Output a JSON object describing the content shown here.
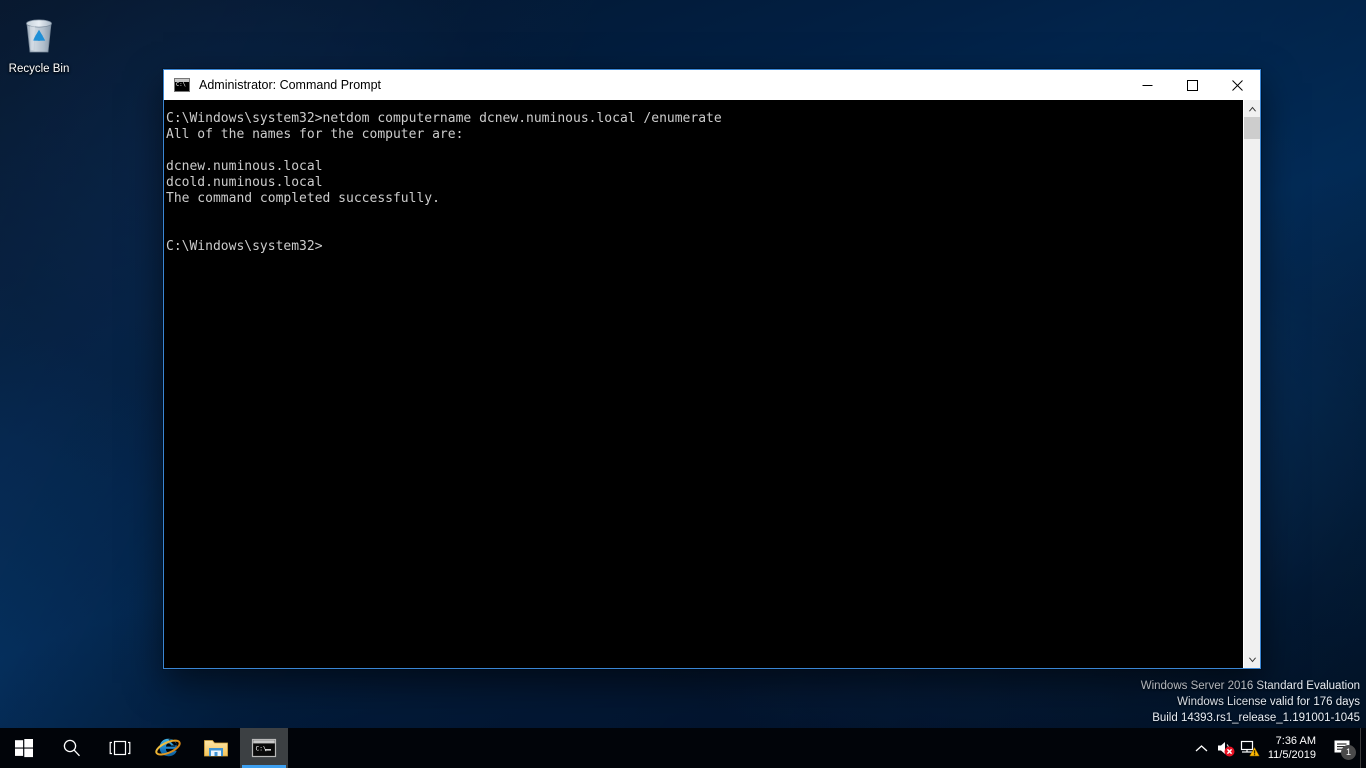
{
  "desktop": {
    "icons": [
      {
        "name": "recycle-bin",
        "label": "Recycle Bin"
      }
    ],
    "wallpaper_color": "#023061"
  },
  "window": {
    "title": "Administrator: Command Prompt",
    "icon": "command-prompt-icon",
    "accent_color": "#3a86d4",
    "controls": {
      "minimize": "—",
      "maximize": "☐",
      "close": "✕"
    },
    "console": {
      "background": "#000000",
      "foreground": "#cccccc",
      "lines": [
        "C:\\Windows\\system32>netdom computername dcnew.numinous.local /enumerate",
        "All of the names for the computer are:",
        "",
        "dcnew.numinous.local",
        "dcold.numinous.local",
        "The command completed successfully.",
        "",
        "",
        "C:\\Windows\\system32>"
      ]
    },
    "scrollbar": {
      "up_arrow": "scroll-up-icon",
      "down_arrow": "scroll-down-icon",
      "thumb_position": "top"
    }
  },
  "watermark": {
    "line1": "Windows Server 2016 Standard Evaluation",
    "line2": "Windows License valid for 176 days",
    "line3": "Build 14393.rs1_release_1.191001-1045"
  },
  "taskbar": {
    "background": "#010409",
    "buttons": [
      {
        "name": "start-button",
        "icon": "windows-logo-icon",
        "label": "Start"
      },
      {
        "name": "search-button",
        "icon": "search-icon",
        "label": "Search"
      },
      {
        "name": "task-view-button",
        "icon": "task-view-icon",
        "label": "Task View"
      }
    ],
    "apps": [
      {
        "name": "taskbar-app-internet-explorer",
        "icon": "internet-explorer-icon",
        "label": "Internet Explorer",
        "active": false
      },
      {
        "name": "taskbar-app-file-explorer",
        "icon": "file-explorer-icon",
        "label": "File Explorer",
        "active": false
      },
      {
        "name": "taskbar-app-command-prompt",
        "icon": "command-prompt-icon",
        "label": "Command Prompt",
        "active": true
      }
    ],
    "tray": {
      "show_hidden": "chevron-up-icon",
      "volume": {
        "icon": "speaker-muted-icon",
        "status": "error"
      },
      "network": {
        "icon": "network-warning-icon",
        "status": "warning"
      },
      "clock": {
        "time": "7:36 AM",
        "date": "11/5/2019"
      },
      "action_center": {
        "icon": "action-center-icon",
        "badge": "1"
      }
    }
  }
}
